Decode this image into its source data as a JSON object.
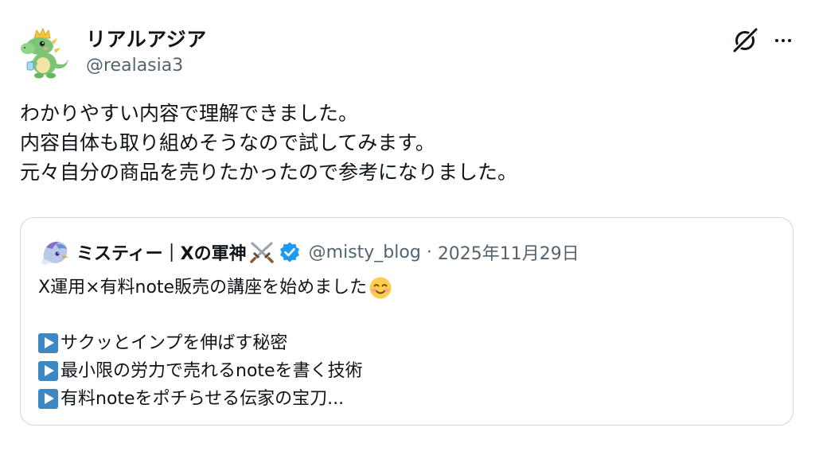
{
  "author": {
    "name": "リアルアジア",
    "handle": "@realasia3",
    "avatar_icon": "dragon-avatar-icon"
  },
  "actions": {
    "grok_icon": "grok-icon",
    "more_icon": "more-icon"
  },
  "tweet": {
    "lines": [
      "わかりやすい内容で理解できました。",
      "内容自体も取り組めそうなので試してみます。",
      "元々自分の商品を売りたかったので参考になりました。"
    ]
  },
  "quote": {
    "name": "ミスティー｜Xの軍神",
    "handle": "@misty_blog",
    "separator": "·",
    "date": "2025年11月29日",
    "line1": "X運用×有料note販売の講座を始めました",
    "bullets": [
      "サクッとインプを伸ばす秘密",
      "最小限の労力で売れるnoteを書く技術",
      "有料noteをポチらせる伝家の宝刀..."
    ],
    "icons": {
      "avatar": "character-avatar-icon",
      "swords": "crossed-swords-icon",
      "verified": "verified-badge-icon",
      "smile": "smiling-face-icon",
      "bullet": "play-button-icon"
    }
  },
  "colors": {
    "text": "#0f1419",
    "secondary": "#536471",
    "border": "#cfd9de",
    "verified": "#1d9bf0",
    "bullet": "#3b88c3"
  }
}
